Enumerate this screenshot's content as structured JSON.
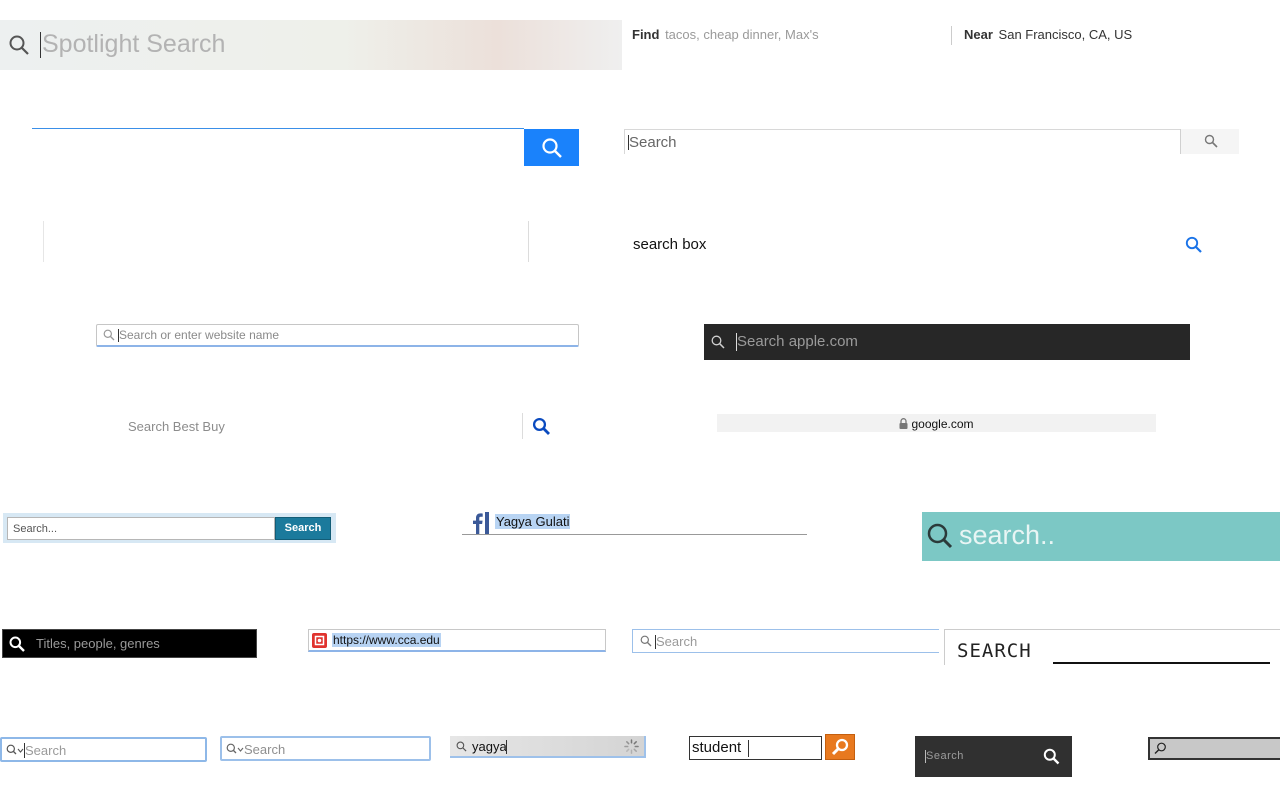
{
  "spotlight": {
    "placeholder": "Spotlight Search",
    "icon": "search-icon"
  },
  "yelp": {
    "find_label": "Find",
    "find_placeholder": "tacos, cheap dinner, Max's",
    "near_label": "Near",
    "near_value": "San Francisco, CA, US"
  },
  "blue_button_search": {
    "value": "",
    "button_icon": "search-icon",
    "accent": "#1a82fb"
  },
  "grey_search": {
    "placeholder": "Search",
    "button_icon": "search-icon"
  },
  "empty_box": {
    "value": ""
  },
  "search_box_text": {
    "value": "search box",
    "icon": "search-icon",
    "accent": "#1a73e8"
  },
  "safari_bar": {
    "placeholder": "Search or enter website name",
    "icon": "search-icon"
  },
  "apple_search": {
    "placeholder": "Search apple.com",
    "icon": "search-icon",
    "bg": "#272727"
  },
  "bestbuy": {
    "placeholder": "Search Best Buy",
    "icon": "search-icon",
    "accent": "#0a4abf"
  },
  "google_address": {
    "url": "google.com",
    "icon": "lock-icon"
  },
  "teal_button_search": {
    "placeholder": "Search...",
    "button_label": "Search",
    "accent": "#1b7a9c"
  },
  "facebook": {
    "value": "Yagya Gulati",
    "icon": "facebook-icon",
    "accent": "#3b5998"
  },
  "teal_large": {
    "placeholder": "search..",
    "icon": "search-icon",
    "bg": "#7cc8c5"
  },
  "netflix": {
    "placeholder": "Titles, people, genres",
    "icon": "search-icon"
  },
  "cca_address": {
    "url": "https://www.cca.edu",
    "icon": "site-favicon"
  },
  "mac_search_1": {
    "placeholder": "Search",
    "icon": "search-icon"
  },
  "retro_search": {
    "label": "SEARCH",
    "value": ""
  },
  "mac_search_2": {
    "placeholder": "Search",
    "icon": "search-dropdown-icon"
  },
  "mac_search_3": {
    "placeholder": "Search",
    "icon": "search-dropdown-icon"
  },
  "loading_search": {
    "value": "yagya",
    "icon": "search-icon",
    "spinner": "loading-spinner-icon"
  },
  "student_search": {
    "value": "student",
    "button_icon": "search-icon",
    "accent": "#e8791f"
  },
  "dark_small_search": {
    "placeholder": "Search",
    "icon": "search-icon",
    "bg": "#303030"
  },
  "grey_tiny_search": {
    "value": "",
    "icon": "search-icon"
  }
}
